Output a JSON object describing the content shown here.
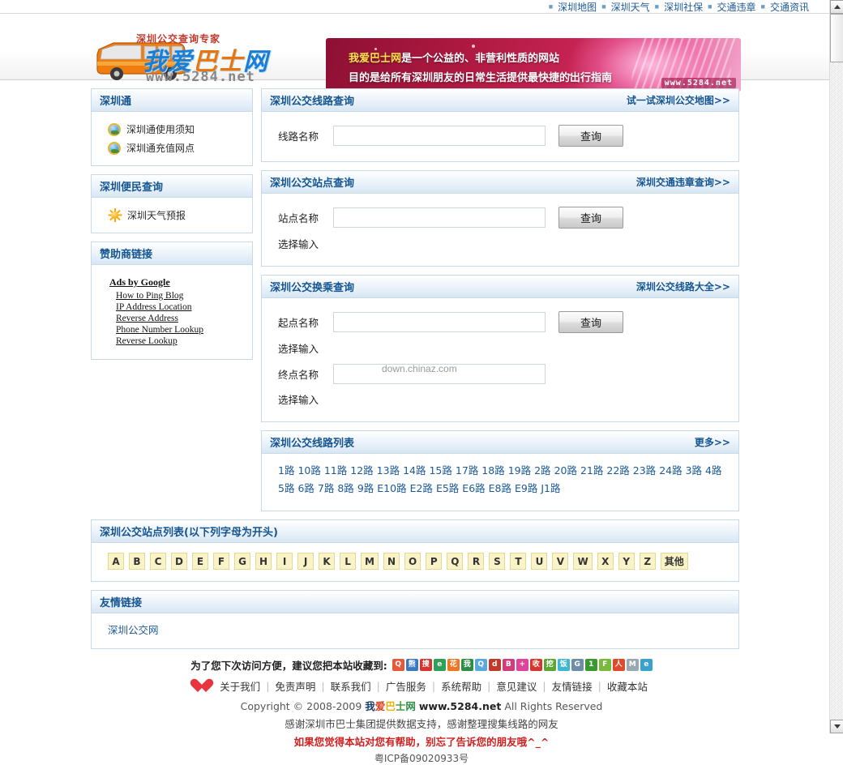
{
  "topnav": {
    "items": [
      {
        "label": "深圳地图"
      },
      {
        "label": "深圳天气"
      },
      {
        "label": "深圳社保"
      },
      {
        "label": "交通违章"
      },
      {
        "label": "交通资讯"
      }
    ]
  },
  "header": {
    "logo_tagline": "深圳公交查询专家",
    "logo_name_1": "我爱",
    "logo_name_2": "巴士",
    "logo_name_3": "网",
    "logo_url": "www.5284.net",
    "banner_line1_highlight": "我爱巴士网",
    "banner_line1_rest": "是一个公益的、非营利性质的网站",
    "banner_line2": "目的是给所有深圳朋友的日常生活提供最快捷的出行指南",
    "banner_url": "www.5284.net"
  },
  "sidebar": {
    "panels": [
      {
        "title": "深圳通",
        "items": [
          {
            "label": "深圳通使用须知",
            "icon": "globe-icon"
          },
          {
            "label": "深圳通充值网点",
            "icon": "globe-icon"
          }
        ]
      },
      {
        "title": "深圳便民查询",
        "items": [
          {
            "label": "深圳天气预报",
            "icon": "sun-icon"
          }
        ]
      }
    ],
    "ads_panel": {
      "title": "赞助商链接",
      "ads_by": "Ads by Google",
      "links": [
        "How to Ping Blog",
        "IP Address Location",
        "Reverse Address",
        "Phone Number Lookup",
        "Reverse Lookup"
      ]
    }
  },
  "main": {
    "route_query": {
      "title": "深圳公交线路查询",
      "more_label": "试一试深圳公交地图>>",
      "field_label": "线路名称",
      "field_value": "",
      "field_placeholder": "",
      "button_label": "查询"
    },
    "station_query": {
      "title": "深圳公交站点查询",
      "more_label": "深圳交通违章查询>>",
      "field_label": "站点名称",
      "field_value": "",
      "field_placeholder": "",
      "button_label": "查询",
      "select_hint": "选择输入"
    },
    "transfer_query": {
      "title": "深圳公交换乘查询",
      "more_label": "深圳公交线路大全>>",
      "start_label": "起点名称",
      "start_value": "",
      "start_hint": "选择输入",
      "end_label": "终点名称",
      "end_value": "",
      "end_hint": "选择输入",
      "button_label": "查询",
      "watermark": "down.chinaz.com"
    },
    "route_list": {
      "title": "深圳公交线路列表",
      "more_label": "更多>>",
      "routes": [
        "1路",
        "10路",
        "11路",
        "12路",
        "13路",
        "14路",
        "15路",
        "17路",
        "18路",
        "19路",
        "2路",
        "20路",
        "21路",
        "22路",
        "23路",
        "24路",
        "3路",
        "4路",
        "5路",
        "6路",
        "7路",
        "8路",
        "9路",
        "E10路",
        "E2路",
        "E5路",
        "E6路",
        "E8路",
        "E9路",
        "J1路"
      ]
    }
  },
  "station_letters": {
    "title": "深圳公交站点列表(以下列字母为开头)",
    "letters": [
      "A",
      "B",
      "C",
      "D",
      "E",
      "F",
      "G",
      "H",
      "I",
      "J",
      "K",
      "L",
      "M",
      "N",
      "O",
      "P",
      "Q",
      "R",
      "S",
      "T",
      "U",
      "V",
      "W",
      "X",
      "Y",
      "Z",
      "其他"
    ]
  },
  "friend_links": {
    "title": "友情链接",
    "links": [
      "深圳公交网"
    ]
  },
  "footer": {
    "bookmark_text": "为了您下次访问方便，建议您把本站收藏到:",
    "bookmark_icons": [
      {
        "name": "qq-icon",
        "glyph": "Q",
        "color": "#e8593c"
      },
      {
        "name": "baidu-icon",
        "glyph": "熊",
        "color": "#3b78c4"
      },
      {
        "name": "sohu-icon",
        "glyph": "搜",
        "color": "#d6342c"
      },
      {
        "name": "ie-circle-icon",
        "glyph": "e",
        "color": "#2fa05a"
      },
      {
        "name": "flower-icon",
        "glyph": "花",
        "color": "#ef7722"
      },
      {
        "name": "wo-icon",
        "glyph": "我",
        "color": "#2d8c46"
      },
      {
        "name": "qzone-icon",
        "glyph": "Q",
        "color": "#5aa8e0"
      },
      {
        "name": "douban-icon",
        "glyph": "d",
        "color": "#c0392b"
      },
      {
        "name": "beta-icon",
        "glyph": "B",
        "color": "#d23c7a"
      },
      {
        "name": "plus-icon",
        "glyph": "+",
        "color": "#e0439a"
      },
      {
        "name": "shou-icon",
        "glyph": "收",
        "color": "#d6342c"
      },
      {
        "name": "wa-icon",
        "glyph": "挖",
        "color": "#5aa832"
      },
      {
        "name": "fan-icon",
        "glyph": "饭",
        "color": "#3fb6d6"
      },
      {
        "name": "google-icon",
        "glyph": "G",
        "color": "#6f8ca8"
      },
      {
        "name": "yi-icon",
        "glyph": "1",
        "color": "#3a9a32"
      },
      {
        "name": "f-icon",
        "glyph": "F",
        "color": "#7ab93c"
      },
      {
        "name": "people-icon",
        "glyph": "人",
        "color": "#e04a2a"
      },
      {
        "name": "mail-icon",
        "glyph": "M",
        "color": "#9aa8b4"
      },
      {
        "name": "ie-icon",
        "glyph": "e",
        "color": "#3aa0d0"
      }
    ],
    "links": [
      "关于我们",
      "免责声明",
      "联系我们",
      "广告服务",
      "系统帮助",
      "意见建议",
      "友情链接",
      "收藏本站"
    ],
    "copyright_prefix": "Copyright © 2008-2009",
    "copyright_brand": [
      "我",
      "爱",
      "巴",
      "士",
      "网"
    ],
    "copyright_site": "www.5284.net",
    "copyright_suffix": "All Rights Reserved",
    "thanks": "感谢深圳市巴士集团提供数据支持，感谢整理搜集线路的网友",
    "redline": "如果您觉得本站对您有帮助，别忘了告诉您的朋友哦^_^",
    "icp": "粤ICP备09020933号"
  }
}
